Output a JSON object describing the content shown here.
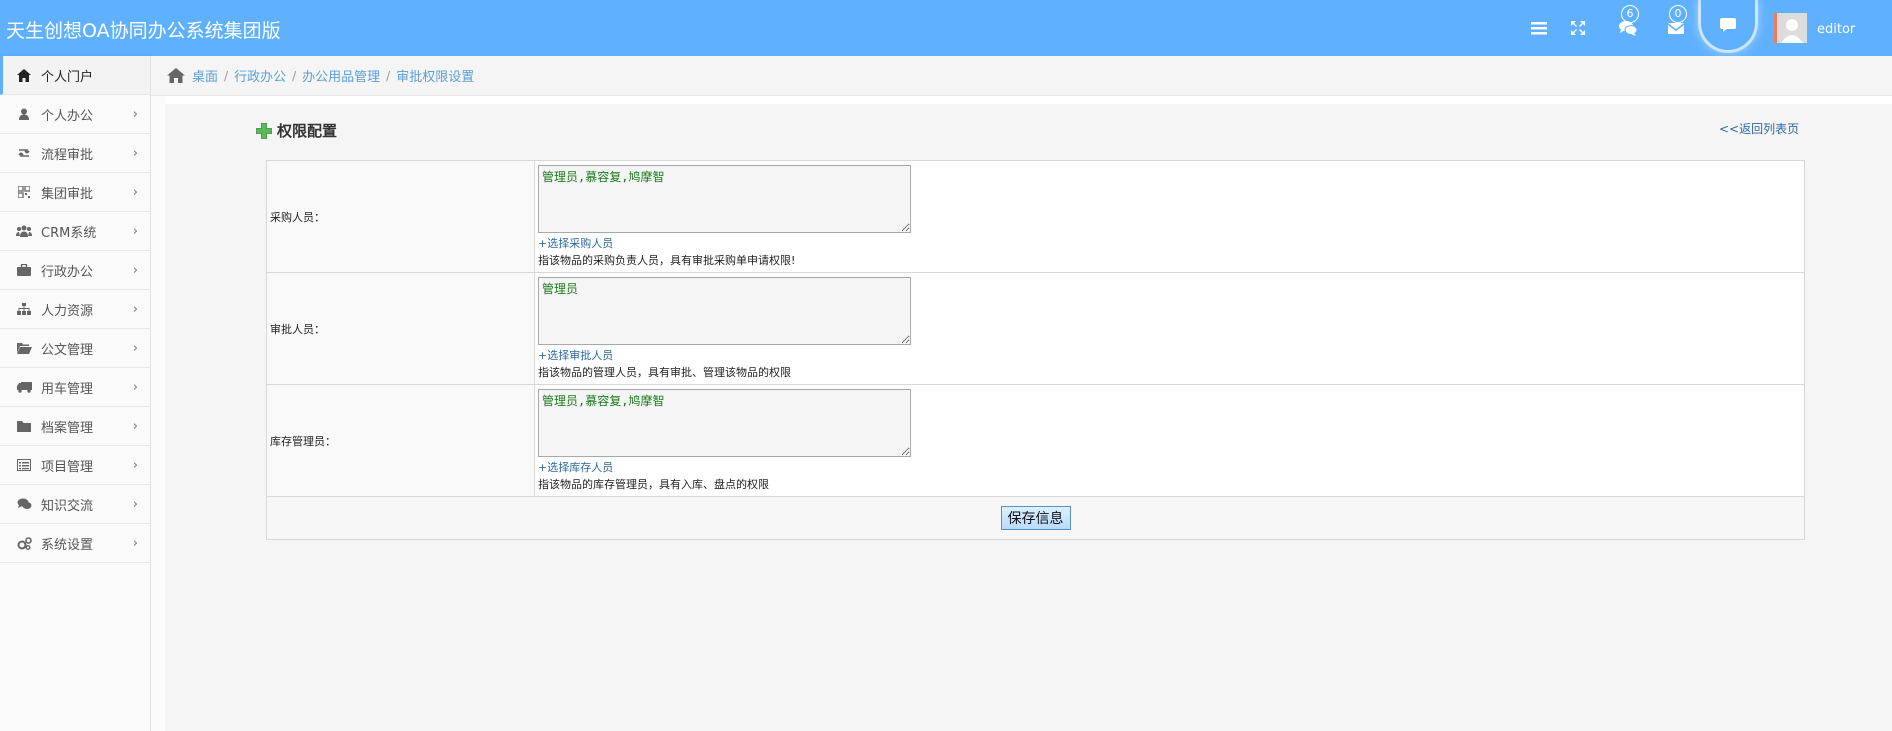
{
  "header": {
    "title": "天生创想OA协同办公系统集团版",
    "messages_badge": "6",
    "mail_badge": "0",
    "username": "editor"
  },
  "sidebar": {
    "items": [
      {
        "label": "个人门户",
        "icon": "home-icon",
        "active": true
      },
      {
        "label": "个人办公",
        "icon": "user-icon"
      },
      {
        "label": "流程审批",
        "icon": "retweet-icon"
      },
      {
        "label": "集团审批",
        "icon": "qrcode-icon"
      },
      {
        "label": "CRM系统",
        "icon": "group-icon"
      },
      {
        "label": "行政办公",
        "icon": "briefcase-icon"
      },
      {
        "label": "人力资源",
        "icon": "sitemap-icon"
      },
      {
        "label": "公文管理",
        "icon": "folder-open-icon"
      },
      {
        "label": "用车管理",
        "icon": "truck-icon"
      },
      {
        "label": "档案管理",
        "icon": "folder-icon"
      },
      {
        "label": "项目管理",
        "icon": "list-alt-icon"
      },
      {
        "label": "知识交流",
        "icon": "comments-icon"
      },
      {
        "label": "系统设置",
        "icon": "cogs-icon"
      }
    ]
  },
  "breadcrumb": {
    "items": [
      "桌面",
      "行政办公",
      "办公用品管理",
      "审批权限设置"
    ]
  },
  "page": {
    "section_title": "权限配置",
    "back_link": "<<返回列表页"
  },
  "form": {
    "rows": [
      {
        "label": "采购人员：",
        "value": "管理员,慕容复,鸠摩智",
        "pick": "+选择采购人员",
        "hint": "指该物品的采购负责人员，具有审批采购单申请权限!"
      },
      {
        "label": "审批人员：",
        "value": "管理员",
        "pick": "+选择审批人员",
        "hint": "指该物品的管理人员，具有审批、管理该物品的权限"
      },
      {
        "label": "库存管理员：",
        "value": "管理员,慕容复,鸠摩智",
        "pick": "+选择库存人员",
        "hint": "指该物品的库存管理员，具有入库、盘点的权限"
      }
    ],
    "save_label": "保存信息"
  },
  "colors": {
    "header_bg": "#5fb1ff",
    "link": "#2c69a5",
    "breadcrumb_link": "#5a9fd8",
    "textarea_text": "#1a7a1a"
  }
}
